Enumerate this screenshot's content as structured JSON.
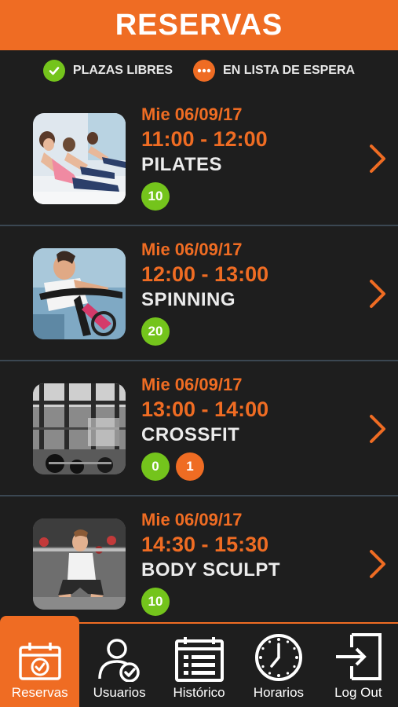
{
  "header": {
    "title": "RESERVAS"
  },
  "legend": {
    "free_label": "PLAZAS LIBRES",
    "waitlist_label": "EN LISTA DE ESPERA"
  },
  "classes": [
    {
      "date": "Mie 06/09/17",
      "time": "11:00 - 12:00",
      "name": "PILATES",
      "free": "10",
      "waitlist": ""
    },
    {
      "date": "Mie 06/09/17",
      "time": "12:00 - 13:00",
      "name": "SPINNING",
      "free": "20",
      "waitlist": ""
    },
    {
      "date": "Mie 06/09/17",
      "time": "13:00 - 14:00",
      "name": "CROSSFIT",
      "free": "0",
      "waitlist": "1"
    },
    {
      "date": "Mie 06/09/17",
      "time": "14:30 - 15:30",
      "name": "BODY SCULPT",
      "free": "10",
      "waitlist": ""
    }
  ],
  "nav": {
    "reservas": "Reservas",
    "usuarios": "Usuarios",
    "historico": "Histórico",
    "horarios": "Horarios",
    "logout": "Log Out"
  },
  "colors": {
    "accent": "#ef6c23",
    "free": "#74c41c",
    "background": "#1e1e1e"
  }
}
